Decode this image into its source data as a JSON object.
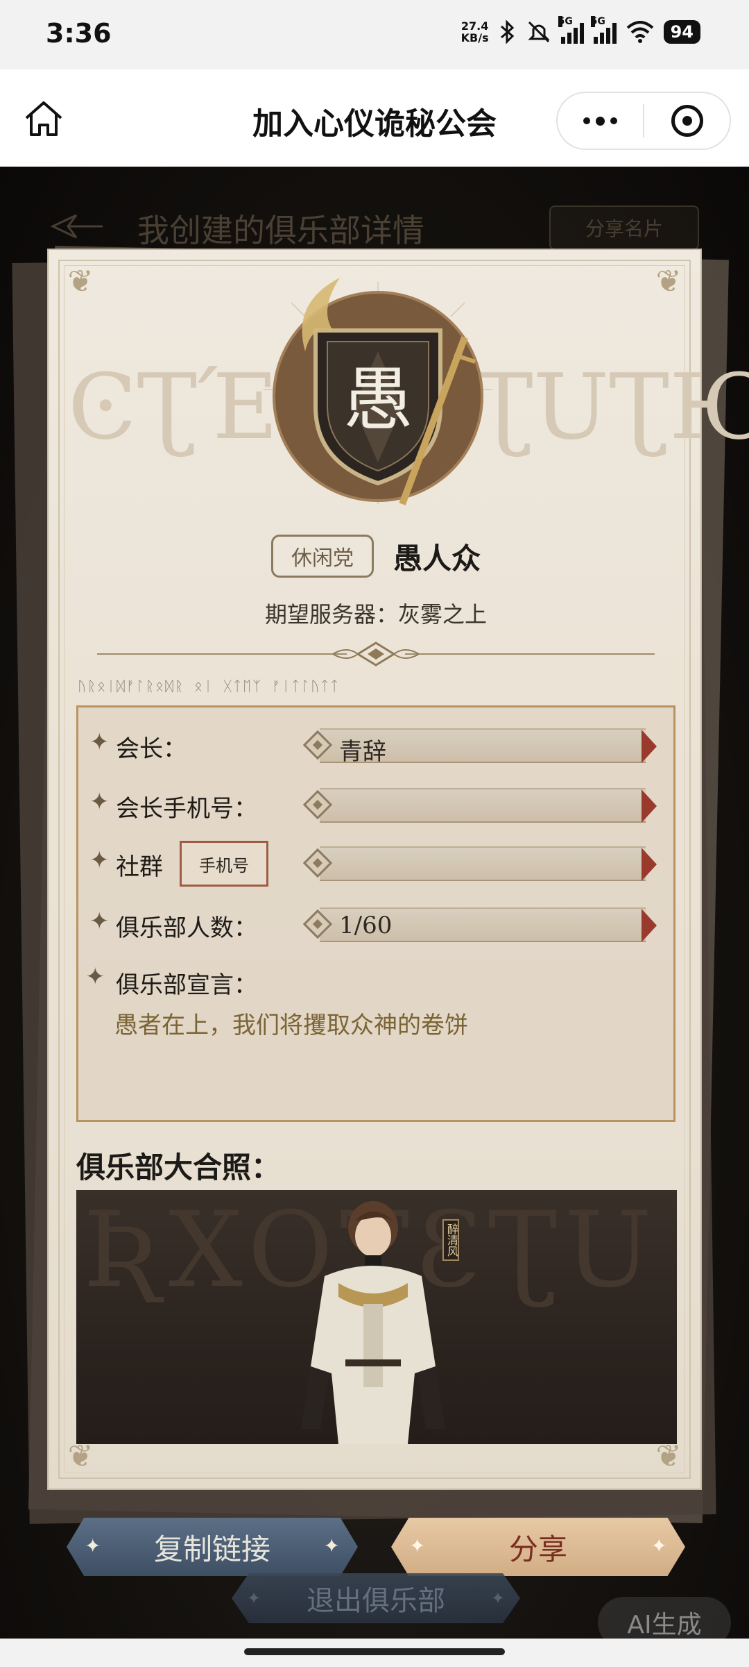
{
  "status_bar": {
    "time": "3:36",
    "net_speed_value": "27.4",
    "net_speed_unit": "KB/s",
    "sim1": "5G",
    "sim2": "5G",
    "battery": "94"
  },
  "title_bar": {
    "title": "加入心仪诡秘公会"
  },
  "background_header": {
    "title": "我创建的俱乐部详情",
    "share_label": "分享名片"
  },
  "card": {
    "emblem_char": "愚",
    "club_tag": "休闲党",
    "club_name": "愚人众",
    "server_label": "期望服务器：",
    "server_value": "灰雾之上",
    "rune_line": "ᚢᚱᛟᛁᛞᚠᛚᚱᛟᛞᚱ ᛟᛁ ᚷᛏᛖᛉ ᚠᛁᛏᛚᚢᛏᛏ",
    "rune_banner_left": "ϾƮΈZ",
    "rune_banner_right": "ƮUƮЮ",
    "fields": [
      {
        "label": "会长：",
        "value": "青辞"
      },
      {
        "label": "会长手机号：",
        "value": ""
      },
      {
        "label": "社群",
        "tag": "手机号",
        "value": ""
      },
      {
        "label": "俱乐部人数：",
        "value": "1/60"
      }
    ],
    "manifesto_label": "俱乐部宣言：",
    "manifesto_text": "愚者在上，我们将攫取众神的卷饼",
    "photo_title": "俱乐部大合照：",
    "photo_rune": "ƦXOƮƐƮU",
    "member_name_tag": "醉清风"
  },
  "actions": {
    "copy_link": "复制链接",
    "share": "分享",
    "exit_club": "退出俱乐部",
    "ai_badge": "AI生成"
  },
  "colors": {
    "accent_copy": "#4b5d73",
    "accent_share": "#dcbb95",
    "card_bg": "#ebe3d6",
    "field_cap": "#9a3a2d"
  }
}
